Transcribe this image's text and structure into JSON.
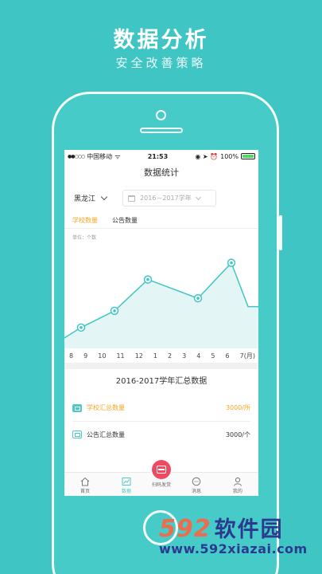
{
  "promo": {
    "title": "数据分析",
    "subtitle": "安全改善策略"
  },
  "status_bar": {
    "signal": "●●○○○",
    "carrier": "中国移动",
    "wifi": "ᯤ",
    "time": "21:53",
    "icons": "◉ ➤ ⏰",
    "battery": "100%"
  },
  "nav": {
    "title": "数据统计"
  },
  "filters": {
    "province": "黑龙江",
    "year_range": "2016－2017学年"
  },
  "tabs": [
    {
      "label": "学校数量",
      "active": true
    },
    {
      "label": "公告数量",
      "active": false
    }
  ],
  "chart_data": {
    "type": "area",
    "unit_label": "单位：个数",
    "x": [
      "8",
      "9",
      "10",
      "11",
      "12",
      "1",
      "2",
      "3",
      "4",
      "5",
      "6",
      "7(月)"
    ],
    "points": [
      {
        "month": "9",
        "value": 1.0
      },
      {
        "month": "11",
        "value": 2.6
      },
      {
        "month": "1",
        "value": 5.6
      },
      {
        "month": "4",
        "value": 3.8
      },
      {
        "month": "6",
        "value": 7.2
      }
    ],
    "series_values": [
      0.0,
      1.0,
      null,
      2.6,
      null,
      5.6,
      null,
      null,
      3.8,
      null,
      7.2,
      3.0
    ],
    "ylim": [
      -1,
      10
    ],
    "colors": {
      "line": "#3fc6c4",
      "fill": "#e3f5f5",
      "marker": "#3fc6c4"
    }
  },
  "summary": {
    "title": "2016-2017学年汇总数据",
    "rows": [
      {
        "icon": "school-card-icon",
        "label": "学校汇总数量",
        "value": "3000/所",
        "highlight": true
      },
      {
        "icon": "notice-card-icon",
        "label": "公告汇总数量",
        "value": "3000/个",
        "highlight": false
      }
    ]
  },
  "tabbar": {
    "items": [
      {
        "label": "首页",
        "icon": "home-icon",
        "active": false
      },
      {
        "label": "数据",
        "icon": "chart-icon",
        "active": true
      },
      {
        "label": "扫码发货",
        "icon": "scan-icon",
        "active": false
      },
      {
        "label": "消息",
        "icon": "message-icon",
        "active": false
      },
      {
        "label": "我的",
        "icon": "profile-icon",
        "active": false
      }
    ]
  },
  "watermark": {
    "number": "592",
    "cn": "软件园",
    "url": "www.592xiazai.com"
  }
}
